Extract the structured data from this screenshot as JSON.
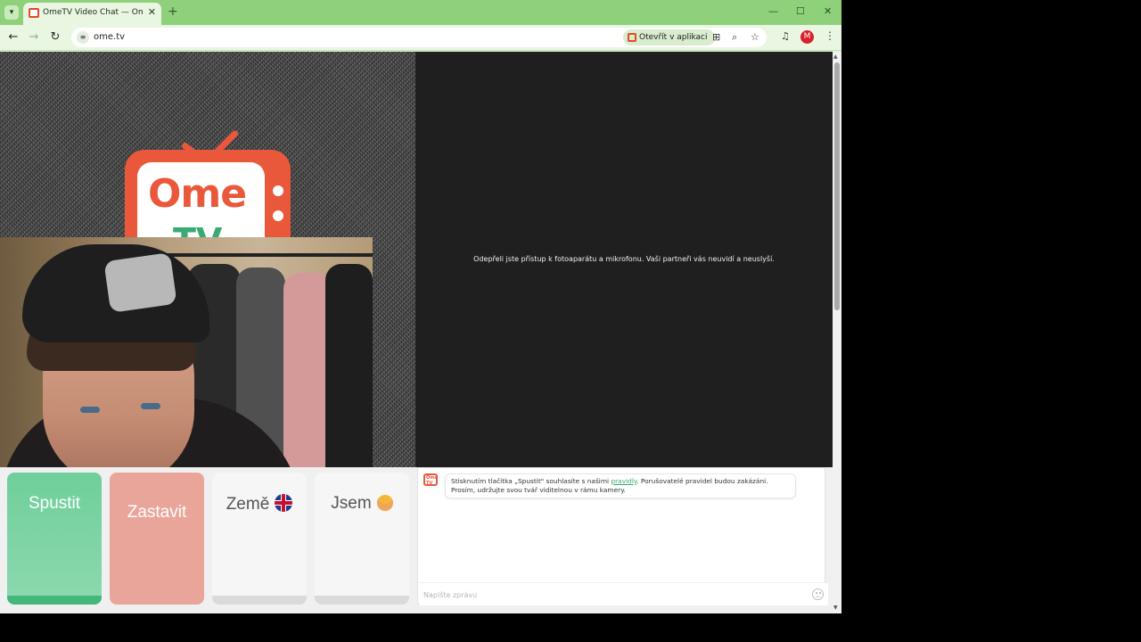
{
  "browser": {
    "tab_title": "OmeTV Video Chat — Omegle",
    "tab_close": "✕",
    "new_tab": "+",
    "url": "ome.tv",
    "open_in_app": "Otevřít v aplikaci",
    "profile_initial": "M",
    "window_controls": {
      "minimize": "—",
      "maximize": "☐",
      "close": "✕"
    },
    "icons": [
      "back-icon",
      "forward-icon",
      "reload-icon",
      "site-info-icon",
      "translate-icon",
      "zoom-icon",
      "bookmark-star-icon",
      "media-icon",
      "menu-icon"
    ],
    "accent": "#8fd07a"
  },
  "page": {
    "logo": {
      "line1": "Ome",
      "line2": "TV"
    },
    "camera_denied_message": "Odepřeli jste přístup k fotoaparátu a mikrofonu. Vaši partneři vás neuvidí a neuslyší.",
    "controls": {
      "start": "Spustit",
      "stop": "Zastavit",
      "country": "Země",
      "gender": "Jsem"
    },
    "chat": {
      "bot_avatar": "Ome TV",
      "message_before_link": "Stisknutím tlačítka „Spustit\" souhlasíte s našimi ",
      "message_link": "pravidly",
      "message_after_link": ". Porušovatelé pravidel budou zakázáni. Prosím, udržujte svou tvář viditelnou v rámu kamery.",
      "input_placeholder": "Napište zprávu"
    },
    "colors": {
      "brand_red": "#e9583a",
      "brand_green": "#3aaa73",
      "start_green": "#6fcf9a",
      "stop_salmon": "#e9a59a"
    }
  }
}
